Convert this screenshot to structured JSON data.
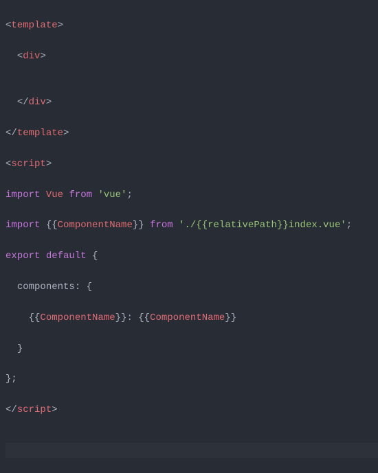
{
  "code": {
    "l1": {
      "open": "<",
      "tag": "template",
      "close": ">"
    },
    "l2": {
      "indent": "  ",
      "open": "<",
      "tag": "div",
      "close": ">"
    },
    "l3": {
      "content": ""
    },
    "l4": {
      "indent": "  ",
      "open": "</",
      "tag": "div",
      "close": ">"
    },
    "l5": {
      "open": "</",
      "tag": "template",
      "close": ">"
    },
    "l6": {
      "open": "<",
      "tag": "script",
      "close": ">"
    },
    "l7": {
      "kw1": "import",
      "sp1": " ",
      "var1": "Vue",
      "sp2": " ",
      "kw2": "from",
      "sp3": " ",
      "str": "'vue'",
      "semi": ";"
    },
    "l8": {
      "kw1": "import",
      "sp1": " ",
      "b1": "{{",
      "var1": "ComponentName",
      "b2": "}}",
      "sp2": " ",
      "kw2": "from",
      "sp3": " ",
      "str1": "'./{{",
      "str2": "relativePath",
      "str3": "}}index.vue'",
      "semi": ";"
    },
    "l9": {
      "kw1": "export",
      "sp1": " ",
      "kw2": "default",
      "sp2": " ",
      "brace": "{"
    },
    "l10": {
      "indent": "  ",
      "prop": "components",
      "colon": ": ",
      "brace": "{"
    },
    "l11": {
      "indent": "    ",
      "b1": "{{",
      "var1": "ComponentName",
      "b2": "}}",
      "colon": ": ",
      "b3": "{{",
      "var2": "ComponentName",
      "b4": "}}"
    },
    "l12": {
      "indent": "  ",
      "brace": "}"
    },
    "l13": {
      "brace": "};"
    },
    "l14": {
      "open": "</",
      "tag": "script",
      "close": ">"
    }
  }
}
